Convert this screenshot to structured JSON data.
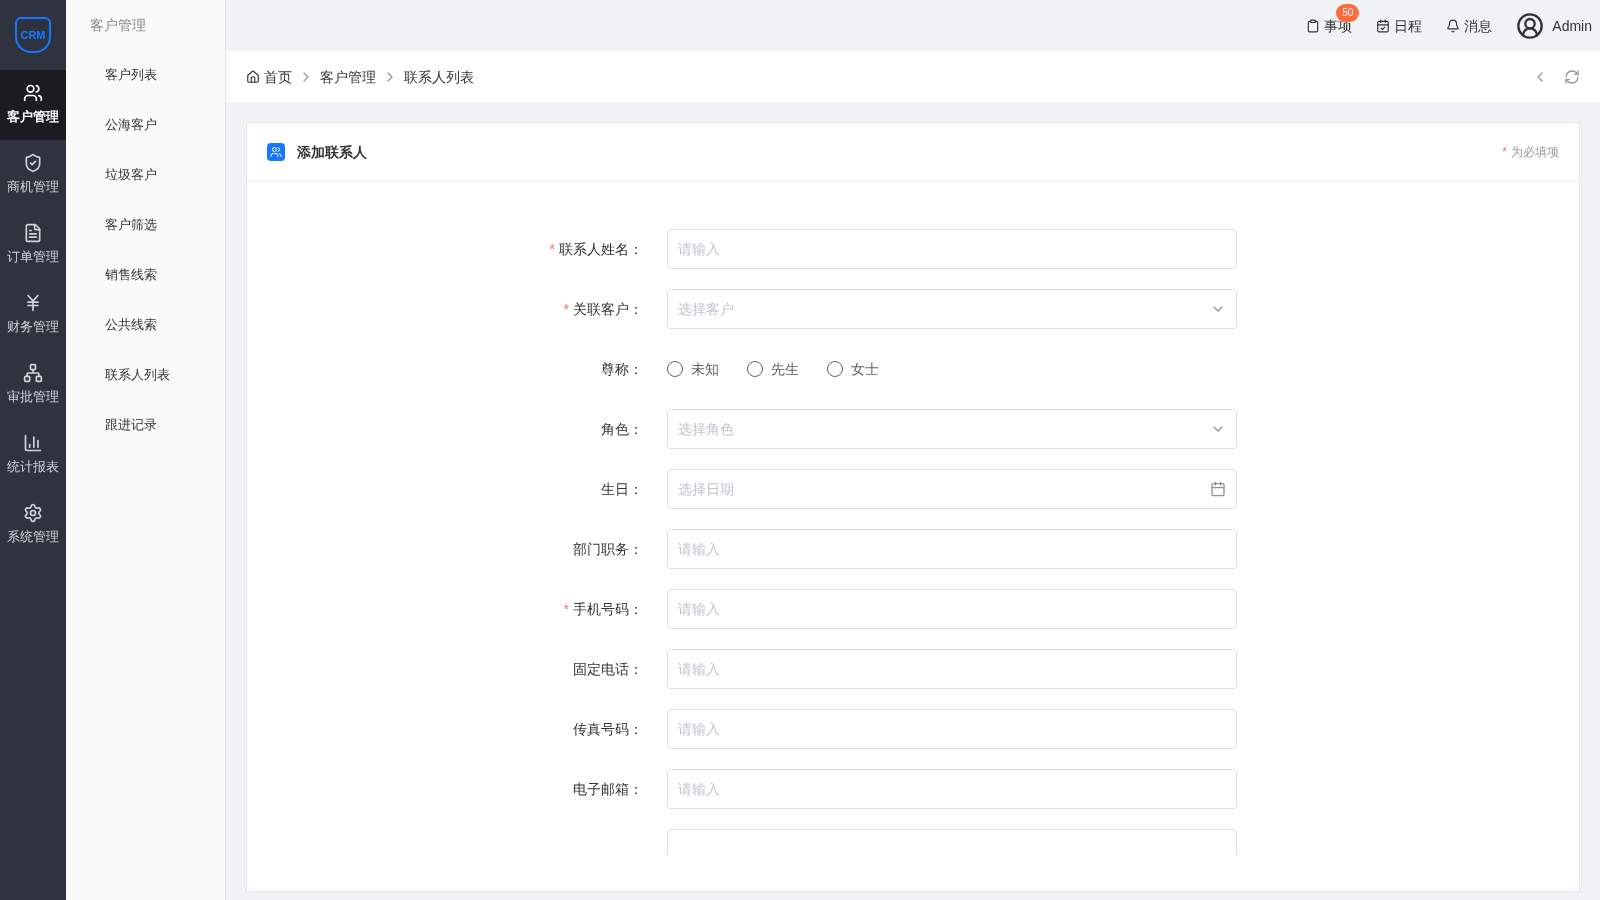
{
  "logo": {
    "text": "CRM"
  },
  "rail": [
    {
      "label": "客户管理",
      "selected": true
    },
    {
      "label": "商机管理",
      "selected": false
    },
    {
      "label": "订单管理",
      "selected": false
    },
    {
      "label": "财务管理",
      "selected": false
    },
    {
      "label": "审批管理",
      "selected": false
    },
    {
      "label": "统计报表",
      "selected": false
    },
    {
      "label": "系统管理",
      "selected": false
    }
  ],
  "submenu": {
    "title": "客户管理",
    "items": [
      "客户列表",
      "公海客户",
      "垃圾客户",
      "客户筛选",
      "销售线索",
      "公共线索",
      "联系人列表",
      "跟进记录"
    ]
  },
  "topbar": {
    "items": [
      {
        "label": "事项",
        "badge": "50"
      },
      {
        "label": "日程"
      },
      {
        "label": "消息"
      }
    ],
    "user": "Admin"
  },
  "breadcrumb": [
    "首页",
    "客户管理",
    "联系人列表"
  ],
  "card": {
    "title": "添加联系人",
    "required_note": {
      "mark": "*",
      "text": "为必填项"
    },
    "fields": [
      {
        "kind": "text",
        "label": "联系人姓名：",
        "mark": "*",
        "placeholder": "请输入"
      },
      {
        "kind": "select",
        "label": "关联客户：",
        "mark": "*",
        "placeholder": "选择客户"
      },
      {
        "kind": "radio",
        "label": "尊称：",
        "options": [
          {
            "label": "未知",
            "selected": false
          },
          {
            "label": "先生",
            "selected": false
          },
          {
            "label": "女士",
            "selected": false
          }
        ]
      },
      {
        "kind": "select",
        "label": "角色：",
        "placeholder": "选择角色"
      },
      {
        "kind": "date",
        "label": "生日：",
        "placeholder": "选择日期"
      },
      {
        "kind": "text",
        "label": "部门职务：",
        "placeholder": "请输入"
      },
      {
        "kind": "text",
        "label": "手机号码：",
        "mark": "*",
        "placeholder": "请输入"
      },
      {
        "kind": "text",
        "label": "固定电话：",
        "placeholder": "请输入"
      },
      {
        "kind": "text",
        "label": "传真号码：",
        "placeholder": "请输入"
      },
      {
        "kind": "text",
        "label": "电子邮箱：",
        "placeholder": "请输入"
      },
      {
        "kind": "text"
      }
    ]
  }
}
